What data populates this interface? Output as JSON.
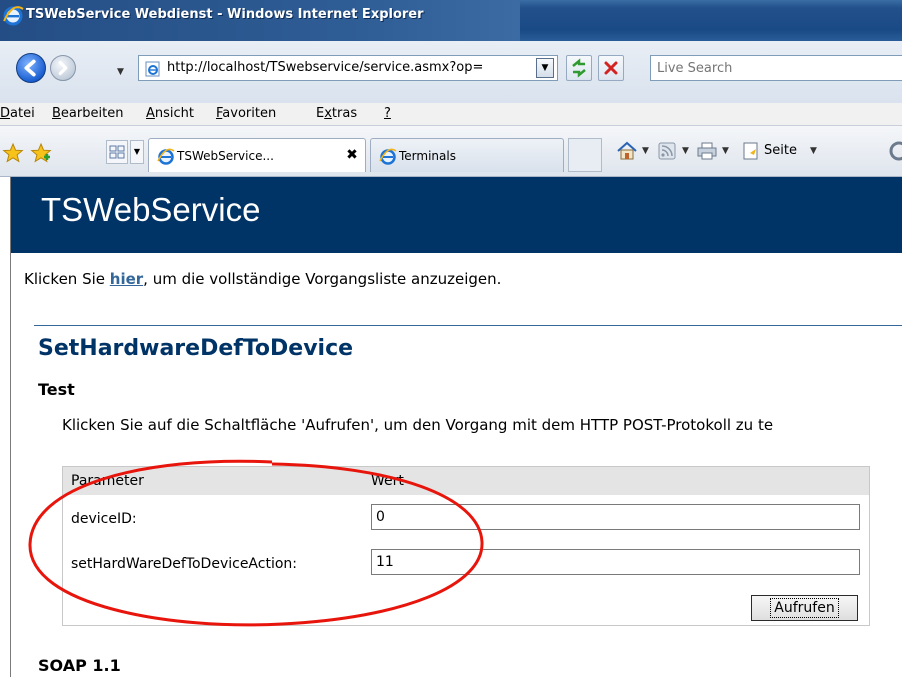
{
  "window": {
    "title": "TSWebService Webdienst - Windows Internet Explorer"
  },
  "address_bar": {
    "url": "http://localhost/TSwebservice/service.asmx?op=",
    "search_placeholder": "Live Search"
  },
  "menu": {
    "items": [
      {
        "label": "Datei",
        "access_key": "D",
        "rest": "atei"
      },
      {
        "label": "Bearbeiten",
        "access_key": "B",
        "rest": "earbeiten"
      },
      {
        "label": "Ansicht",
        "access_key": "A",
        "rest": "nsicht"
      },
      {
        "label": "Favoriten",
        "access_key": "F",
        "rest": "avoriten"
      },
      {
        "label": "Extras",
        "pre": "E",
        "access_key": "x",
        "rest": "tras"
      },
      {
        "label": "?",
        "access_key": "?",
        "rest": ""
      }
    ]
  },
  "tabs": [
    {
      "label": "TSWebService...",
      "active": true,
      "close_label": "✖"
    },
    {
      "label": "Terminals",
      "active": false
    }
  ],
  "command_bar": {
    "page_label": "Seite"
  },
  "page": {
    "title": "TSWebService",
    "intro_before": "Klicken Sie ",
    "intro_link": "hier",
    "intro_after": ", um die vollständige Vorgangsliste anzuzeigen.",
    "operation_title": "SetHardwareDefToDevice",
    "test_heading": "Test",
    "test_description": "Klicken Sie auf die Schaltfläche 'Aufrufen', um den Vorgang mit dem HTTP POST-Protokoll zu te",
    "table": {
      "col_parameter": "Parameter",
      "col_value": "Wert",
      "rows": [
        {
          "name": "deviceID:",
          "value": "0"
        },
        {
          "name": "setHardWareDefToDeviceAction:",
          "value": "11"
        }
      ],
      "submit_label": "Aufrufen"
    },
    "soap_heading": "SOAP 1.1"
  },
  "colors": {
    "header_bg": "#003366",
    "link": "#336699",
    "annotation": "#e8150c"
  },
  "icons": [
    "ie-logo-icon",
    "back-icon",
    "forward-icon",
    "page-icon",
    "refresh-icon",
    "stop-icon",
    "favorites-star-icon",
    "add-favorites-icon",
    "quick-tabs-icon",
    "home-icon",
    "feeds-icon",
    "print-icon",
    "page-menu-icon"
  ]
}
